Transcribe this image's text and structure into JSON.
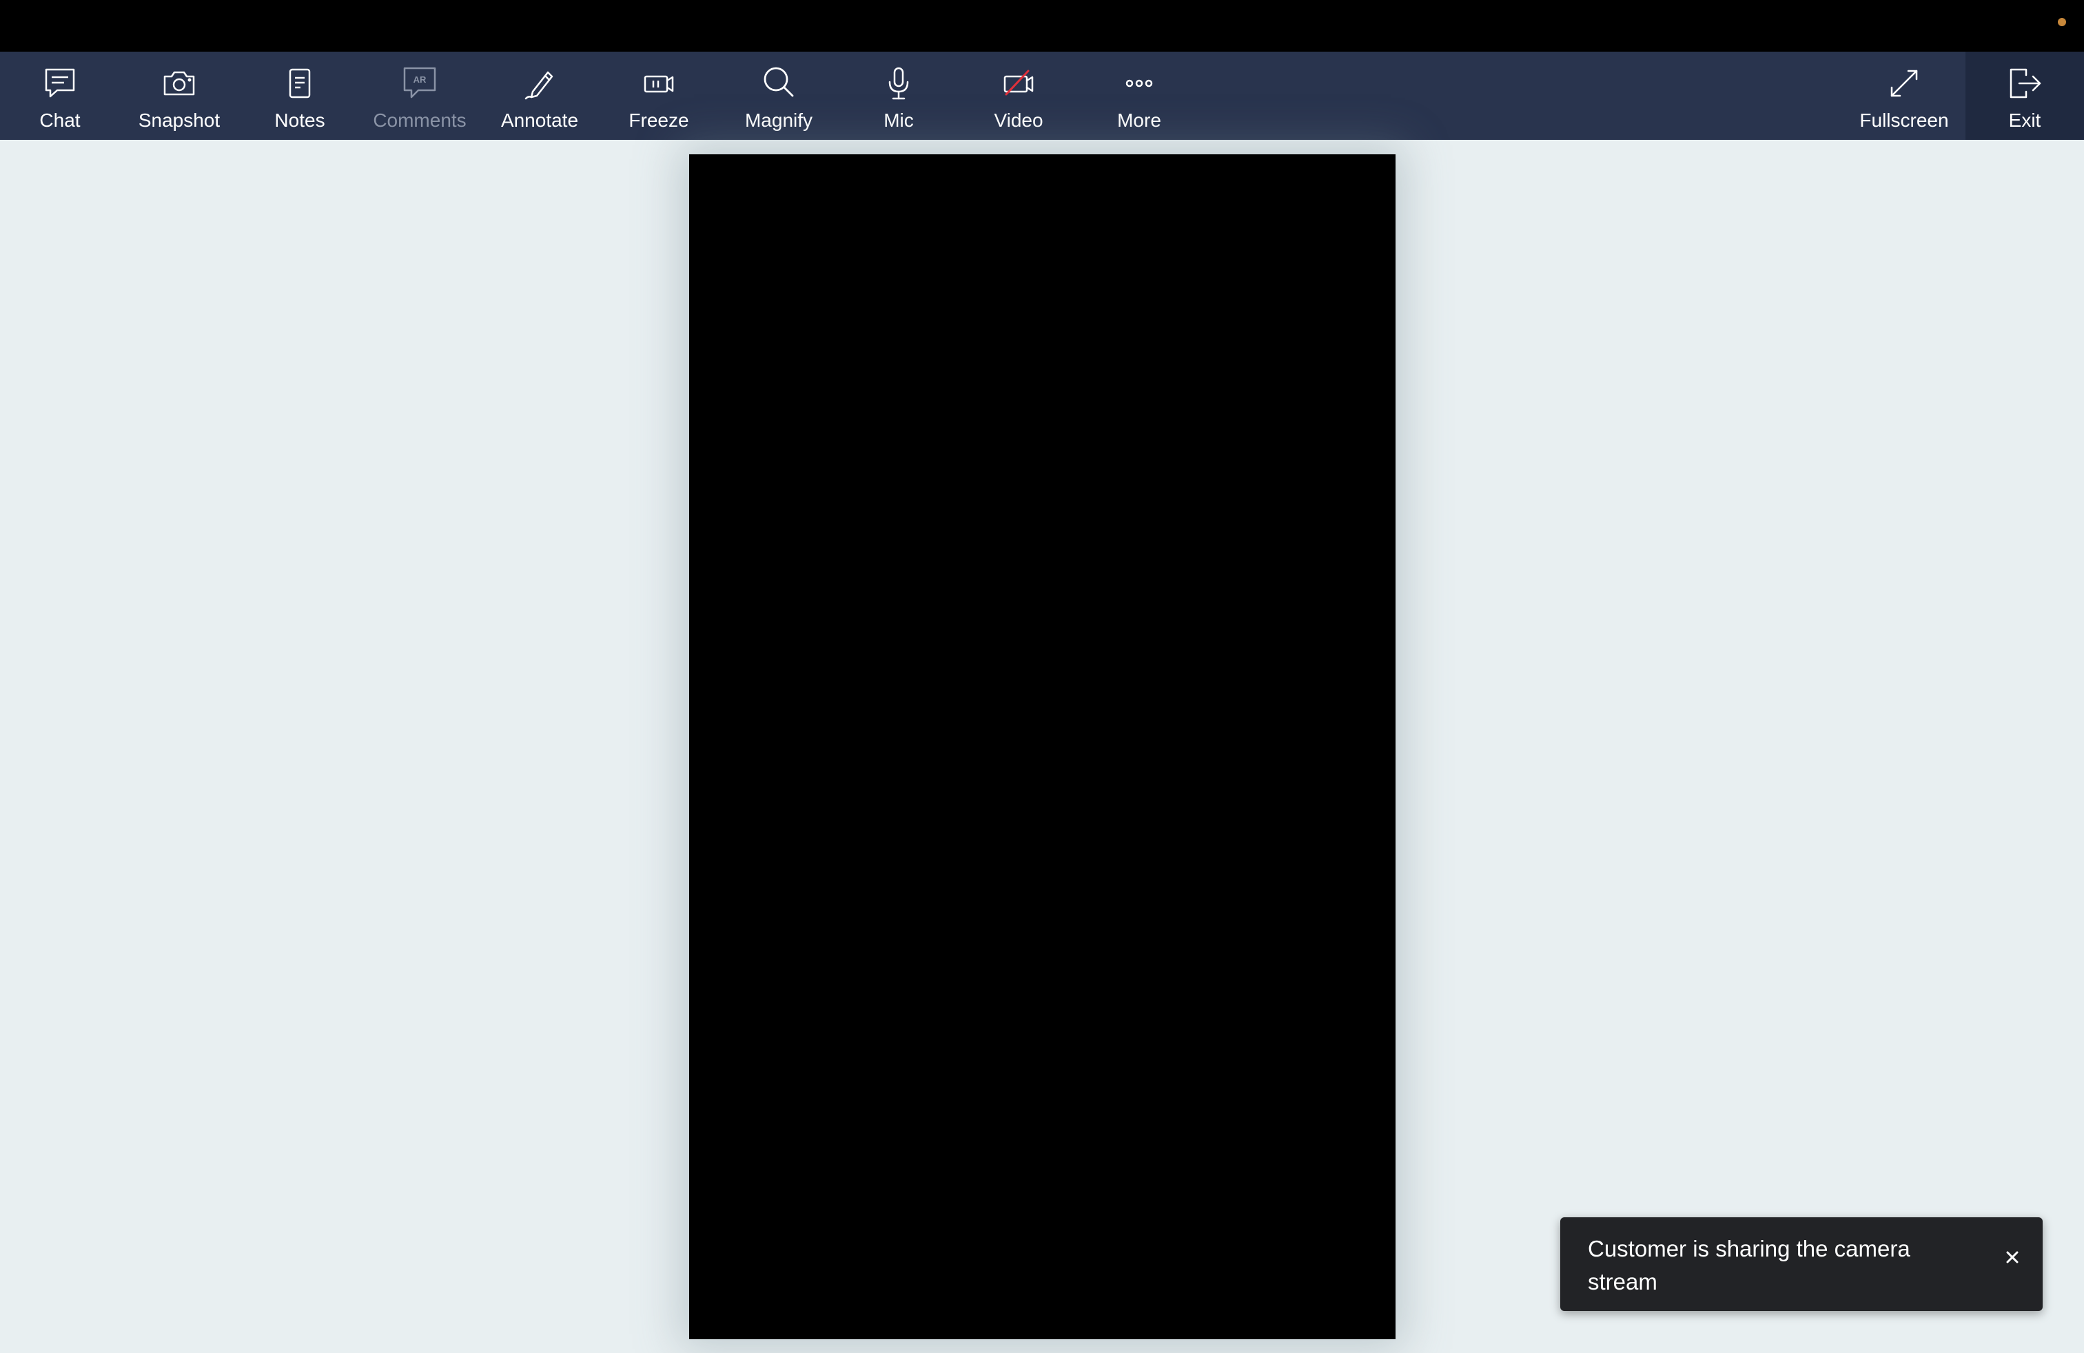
{
  "toolbar": {
    "chat": "Chat",
    "snapshot": "Snapshot",
    "notes": "Notes",
    "comments": "Comments",
    "comments_badge": "AR",
    "annotate": "Annotate",
    "freeze": "Freeze",
    "magnify": "Magnify",
    "mic": "Mic",
    "video": "Video",
    "more": "More",
    "fullscreen": "Fullscreen",
    "exit": "Exit"
  },
  "icons": {
    "chat": "chat-bubble-icon",
    "snapshot": "camera-icon",
    "notes": "document-icon",
    "comments": "ar-comment-icon",
    "annotate": "pen-icon",
    "freeze": "freeze-icon",
    "magnify": "magnifier-icon",
    "mic": "microphone-icon",
    "video": "video-off-icon",
    "more": "ellipsis-icon",
    "fullscreen": "expand-icon",
    "exit": "exit-icon",
    "close": "close-icon"
  },
  "toast": {
    "message": "Customer is sharing the camera stream"
  },
  "colors": {
    "toolbar_bg": "#29344e",
    "exit_bg": "#1f2940",
    "page_bg": "#e8eff1",
    "video_off_slash": "#e0303a",
    "recording_dot": "#c8883a",
    "toast_bg": "#222326",
    "disabled_text": "#8a93a6"
  }
}
